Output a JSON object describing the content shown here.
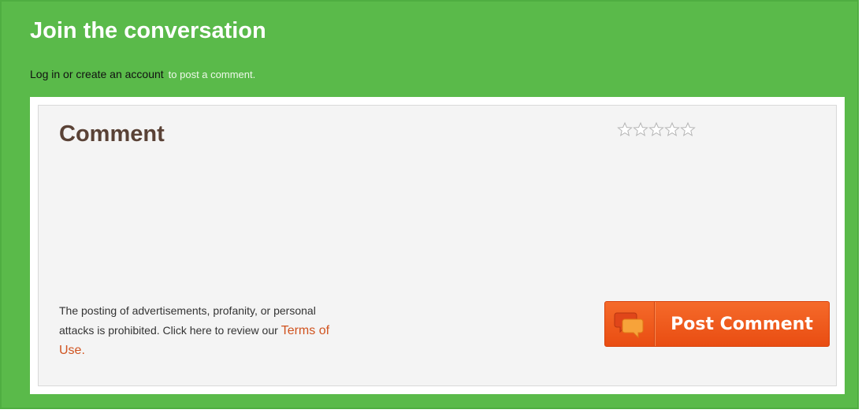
{
  "header": {
    "title": "Join the conversation",
    "login_link": "Log in or create an account",
    "login_suffix": "to post a comment."
  },
  "form": {
    "heading": "Comment",
    "rating": {
      "max": 5,
      "value": 0
    },
    "comment_value": "",
    "disclaimer": "The posting of advertisements, profanity, or personal attacks is prohibited. Click here to review our",
    "terms_link": "Terms of Use.",
    "post_button_label": "Post Comment",
    "post_button_icon": "speech-bubbles-icon"
  },
  "colors": {
    "panel_bg": "#5aba4a",
    "form_bg": "#f4f4f4",
    "heading": "#5a4236",
    "button": "#f05a1e",
    "link": "#d0531f"
  }
}
